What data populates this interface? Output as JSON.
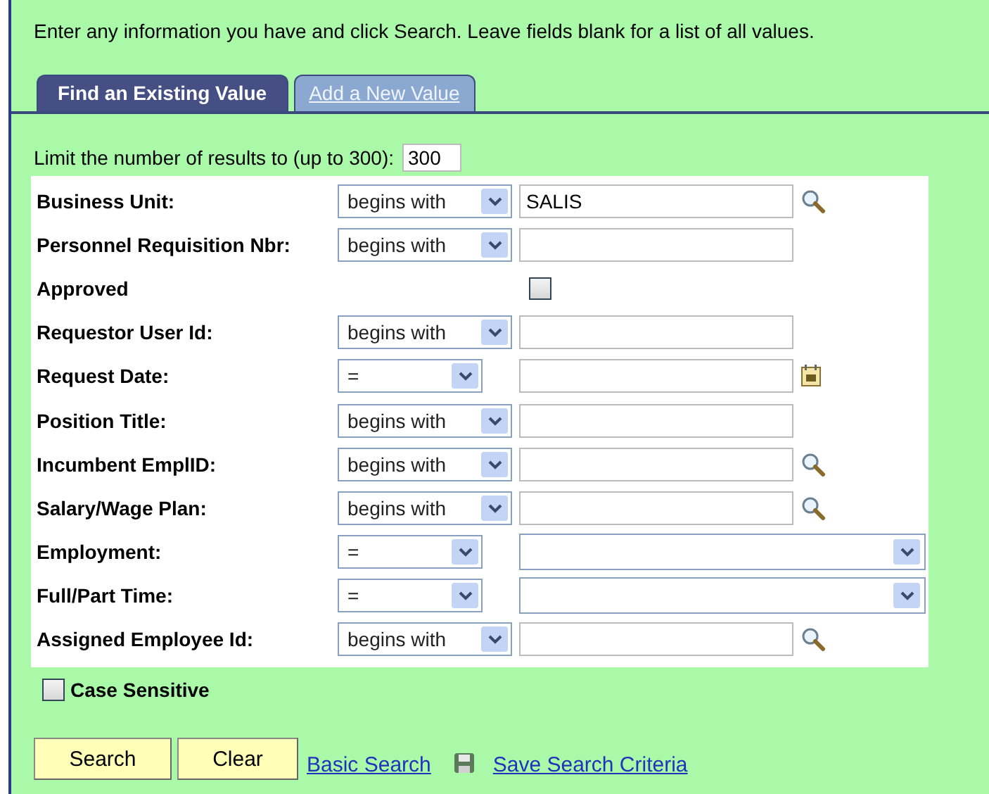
{
  "instructions": "Enter any information you have and click Search. Leave fields blank for a list of all values.",
  "tabs": [
    {
      "label": "Find an Existing Value",
      "selected": true
    },
    {
      "label": "Add a New Value",
      "selected": false
    }
  ],
  "limit": {
    "label": "Limit the number of results to (up to 300):",
    "value": "300"
  },
  "rows": [
    {
      "kind": "text",
      "label": "Business Unit:",
      "operator": "begins with",
      "value": "SALIS",
      "lookup": true,
      "calendar": false
    },
    {
      "kind": "text",
      "label": "Personnel Requisition Nbr:",
      "operator": "begins with",
      "value": "",
      "lookup": false,
      "calendar": false
    },
    {
      "kind": "checkbox",
      "label": "Approved",
      "checked": false
    },
    {
      "kind": "text",
      "label": "Requestor User Id:",
      "operator": "begins with",
      "value": "",
      "lookup": false,
      "calendar": false
    },
    {
      "kind": "text",
      "label": "Request Date:",
      "operator": "=",
      "value": "",
      "lookup": false,
      "calendar": true
    },
    {
      "kind": "text",
      "label": "Position Title:",
      "operator": "begins with",
      "value": "",
      "lookup": false,
      "calendar": false
    },
    {
      "kind": "text",
      "label": "Incumbent EmplID:",
      "operator": "begins with",
      "value": "",
      "lookup": true,
      "calendar": false
    },
    {
      "kind": "text",
      "label": "Salary/Wage Plan:",
      "operator": "begins with",
      "value": "",
      "lookup": true,
      "calendar": false
    },
    {
      "kind": "select",
      "label": "Employment:",
      "operator": "=",
      "value": ""
    },
    {
      "kind": "select",
      "label": "Full/Part Time:",
      "operator": "=",
      "value": ""
    },
    {
      "kind": "text",
      "label": "Assigned Employee Id:",
      "operator": "begins with",
      "value": "",
      "lookup": true,
      "calendar": false
    }
  ],
  "case_sensitive": {
    "label": "Case Sensitive",
    "checked": false
  },
  "buttons": [
    "Search",
    "Clear"
  ],
  "links": [
    {
      "label": "Basic Search",
      "icon": false
    },
    {
      "label": "Save Search Criteria",
      "icon": true
    }
  ]
}
